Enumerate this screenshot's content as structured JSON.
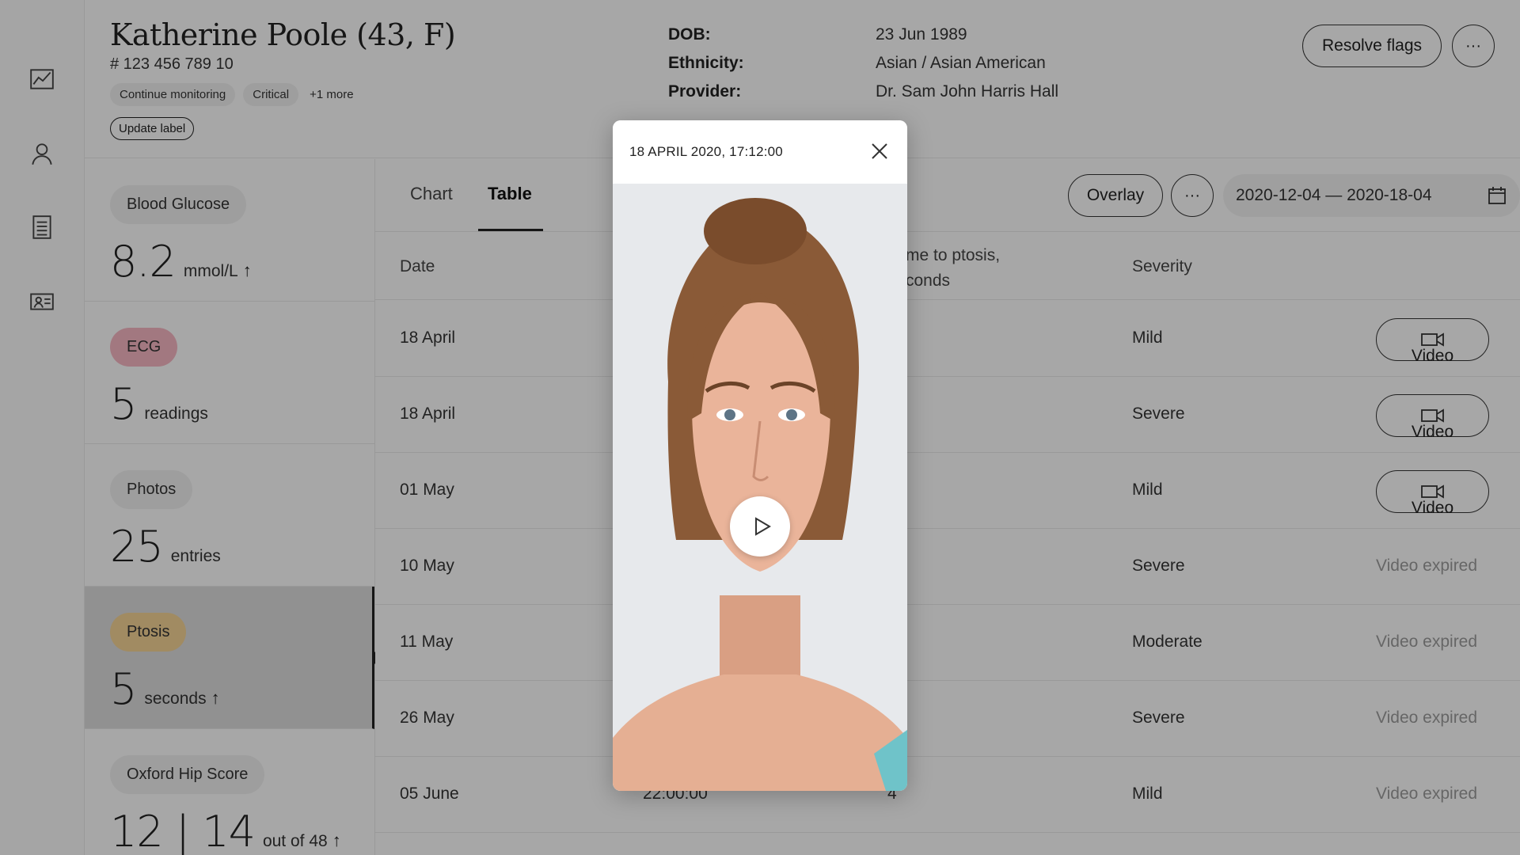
{
  "patient": {
    "name": "Katherine Poole (43, F)",
    "id": "# 123 456 789 10",
    "tags": [
      "Continue monitoring",
      "Critical"
    ],
    "more_tags": "+1 more",
    "update_label": "Update label"
  },
  "info": [
    {
      "key": "DOB:",
      "value": "23 Jun 1989"
    },
    {
      "key": "Ethnicity:",
      "value": "Asian / Asian American"
    },
    {
      "key": "Provider:",
      "value": "Dr. Sam John Harris Hall"
    }
  ],
  "header_actions": {
    "resolve": "Resolve flags",
    "more": "···"
  },
  "rail": [
    "chart-icon",
    "user-icon",
    "document-icon",
    "id-card-icon"
  ],
  "metrics": [
    {
      "label": "Blood Glucose",
      "value": "8.2",
      "unit": "mmol/L",
      "arrow": "↑",
      "color": "#ececec"
    },
    {
      "label": "ECG",
      "value": "5",
      "unit": "readings",
      "arrow": "",
      "color": "#f2b3bf"
    },
    {
      "label": "Photos",
      "value": "25",
      "unit": "entries",
      "arrow": "",
      "color": "#ececec"
    },
    {
      "label": "Ptosis",
      "value": "5",
      "unit": "seconds",
      "arrow": "↑",
      "color": "#f0cf93"
    },
    {
      "label": "Oxford Hip Score",
      "value": "12 | 14",
      "unit": "out of 48",
      "arrow": "↑",
      "color": "#ececec"
    }
  ],
  "tabs": {
    "chart": "Chart",
    "table": "Table"
  },
  "toolbar": {
    "overlay": "Overlay",
    "more": "···",
    "date_range": "2020-12-04 — 2020-18-04"
  },
  "table": {
    "headers": {
      "date": "Date",
      "ptosis_line1": "me to ptosis,",
      "ptosis_line2": "conds",
      "severity": "Severity"
    },
    "rows": [
      {
        "date": "18 April",
        "time": "",
        "value": "",
        "severity": "Mild",
        "video": "Video",
        "video_available": true
      },
      {
        "date": "18 April",
        "time": "",
        "value": "",
        "severity": "Severe",
        "video": "Video",
        "video_available": true
      },
      {
        "date": "01 May",
        "time": "",
        "value": "",
        "severity": "Mild",
        "video": "Video",
        "video_available": true
      },
      {
        "date": "10 May",
        "time": "",
        "value": "",
        "severity": "Severe",
        "video": "Video expired",
        "video_available": false
      },
      {
        "date": "11 May",
        "time": "",
        "value": "",
        "severity": "Moderate",
        "video": "Video expired",
        "video_available": false
      },
      {
        "date": "26 May",
        "time": "",
        "value": "",
        "severity": "Severe",
        "video": "Video expired",
        "video_available": false
      },
      {
        "date": "05 June",
        "time": "22:00:00",
        "value": "4",
        "severity": "Mild",
        "video": "Video expired",
        "video_available": false
      }
    ]
  },
  "modal": {
    "title": "18 APRIL 2020, 17:12:00"
  },
  "colors": {
    "ecg": "#f2b3bf",
    "ptosis": "#f0cf93",
    "active_metric": "#d8d8d8"
  }
}
